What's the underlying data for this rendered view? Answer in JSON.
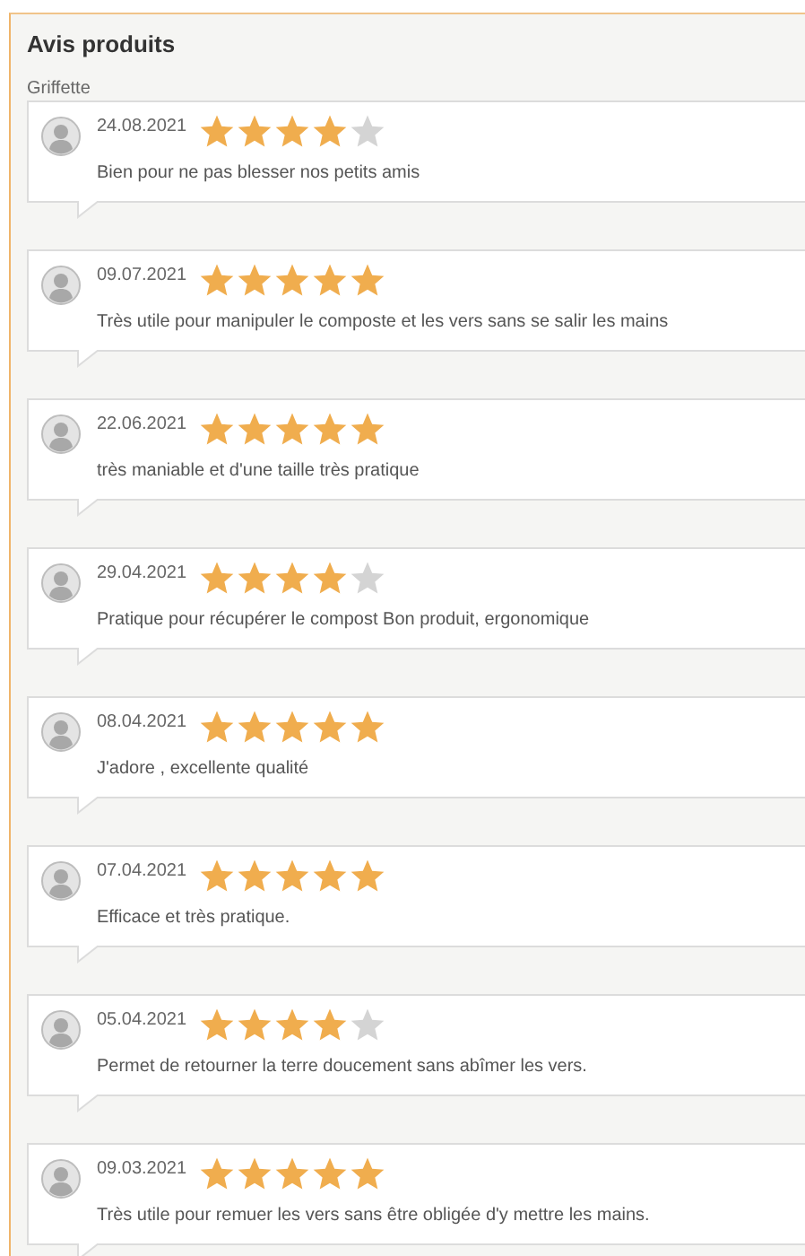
{
  "title": "Avis produits",
  "product": "Griffette",
  "reviews": [
    {
      "date": "24.08.2021",
      "stars": 4,
      "text": "Bien pour ne pas blesser nos petits amis"
    },
    {
      "date": "09.07.2021",
      "stars": 5,
      "text": "Très utile pour manipuler le composte et les vers sans se salir les mains"
    },
    {
      "date": "22.06.2021",
      "stars": 5,
      "text": "très maniable et d'une taille très pratique"
    },
    {
      "date": "29.04.2021",
      "stars": 4,
      "text": "Pratique pour récupérer le compost Bon produit, ergonomique"
    },
    {
      "date": "08.04.2021",
      "stars": 5,
      "text": "J'adore , excellente qualité"
    },
    {
      "date": "07.04.2021",
      "stars": 5,
      "text": "Efficace et très pratique."
    },
    {
      "date": "05.04.2021",
      "stars": 4,
      "text": "Permet de retourner la terre doucement sans abîmer les vers."
    },
    {
      "date": "09.03.2021",
      "stars": 5,
      "text": "Très utile pour remuer les vers sans être obligée d'y mettre les mains."
    }
  ]
}
